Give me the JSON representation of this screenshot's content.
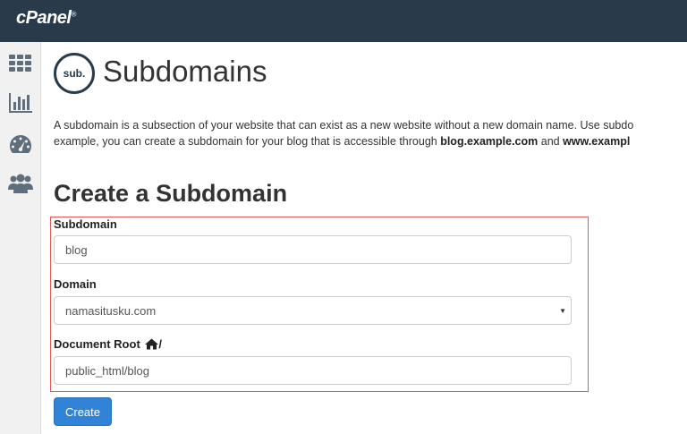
{
  "app": {
    "logo_text": "cPanel",
    "logo_mark": "®"
  },
  "sidebar": {
    "items": [
      {
        "icon": "grid-icon"
      },
      {
        "icon": "bar-chart-icon"
      },
      {
        "icon": "dashboard-gauge-icon"
      },
      {
        "icon": "users-icon"
      }
    ]
  },
  "page": {
    "badge": "sub.",
    "title": "Subdomains",
    "description_line1": "A subdomain is a subsection of your website that can exist as a new website without a new domain name. Use subdo",
    "description_line2_prefix": "example, you can create a subdomain for your blog that is accessible through ",
    "description_link1": "blog.example.com",
    "description_mid": " and ",
    "description_link2": "www.exampl"
  },
  "form": {
    "section_title": "Create a Subdomain",
    "subdomain_label": "Subdomain",
    "subdomain_value": "blog",
    "domain_label": "Domain",
    "domain_value": "namasitusku.com",
    "docroot_label": "Document Root",
    "docroot_suffix": "/",
    "docroot_value": "public_html/blog",
    "submit_label": "Create"
  },
  "colors": {
    "topbar": "#293a4a",
    "highlight_border": "#e5585a",
    "primary_button": "#3083d6"
  }
}
